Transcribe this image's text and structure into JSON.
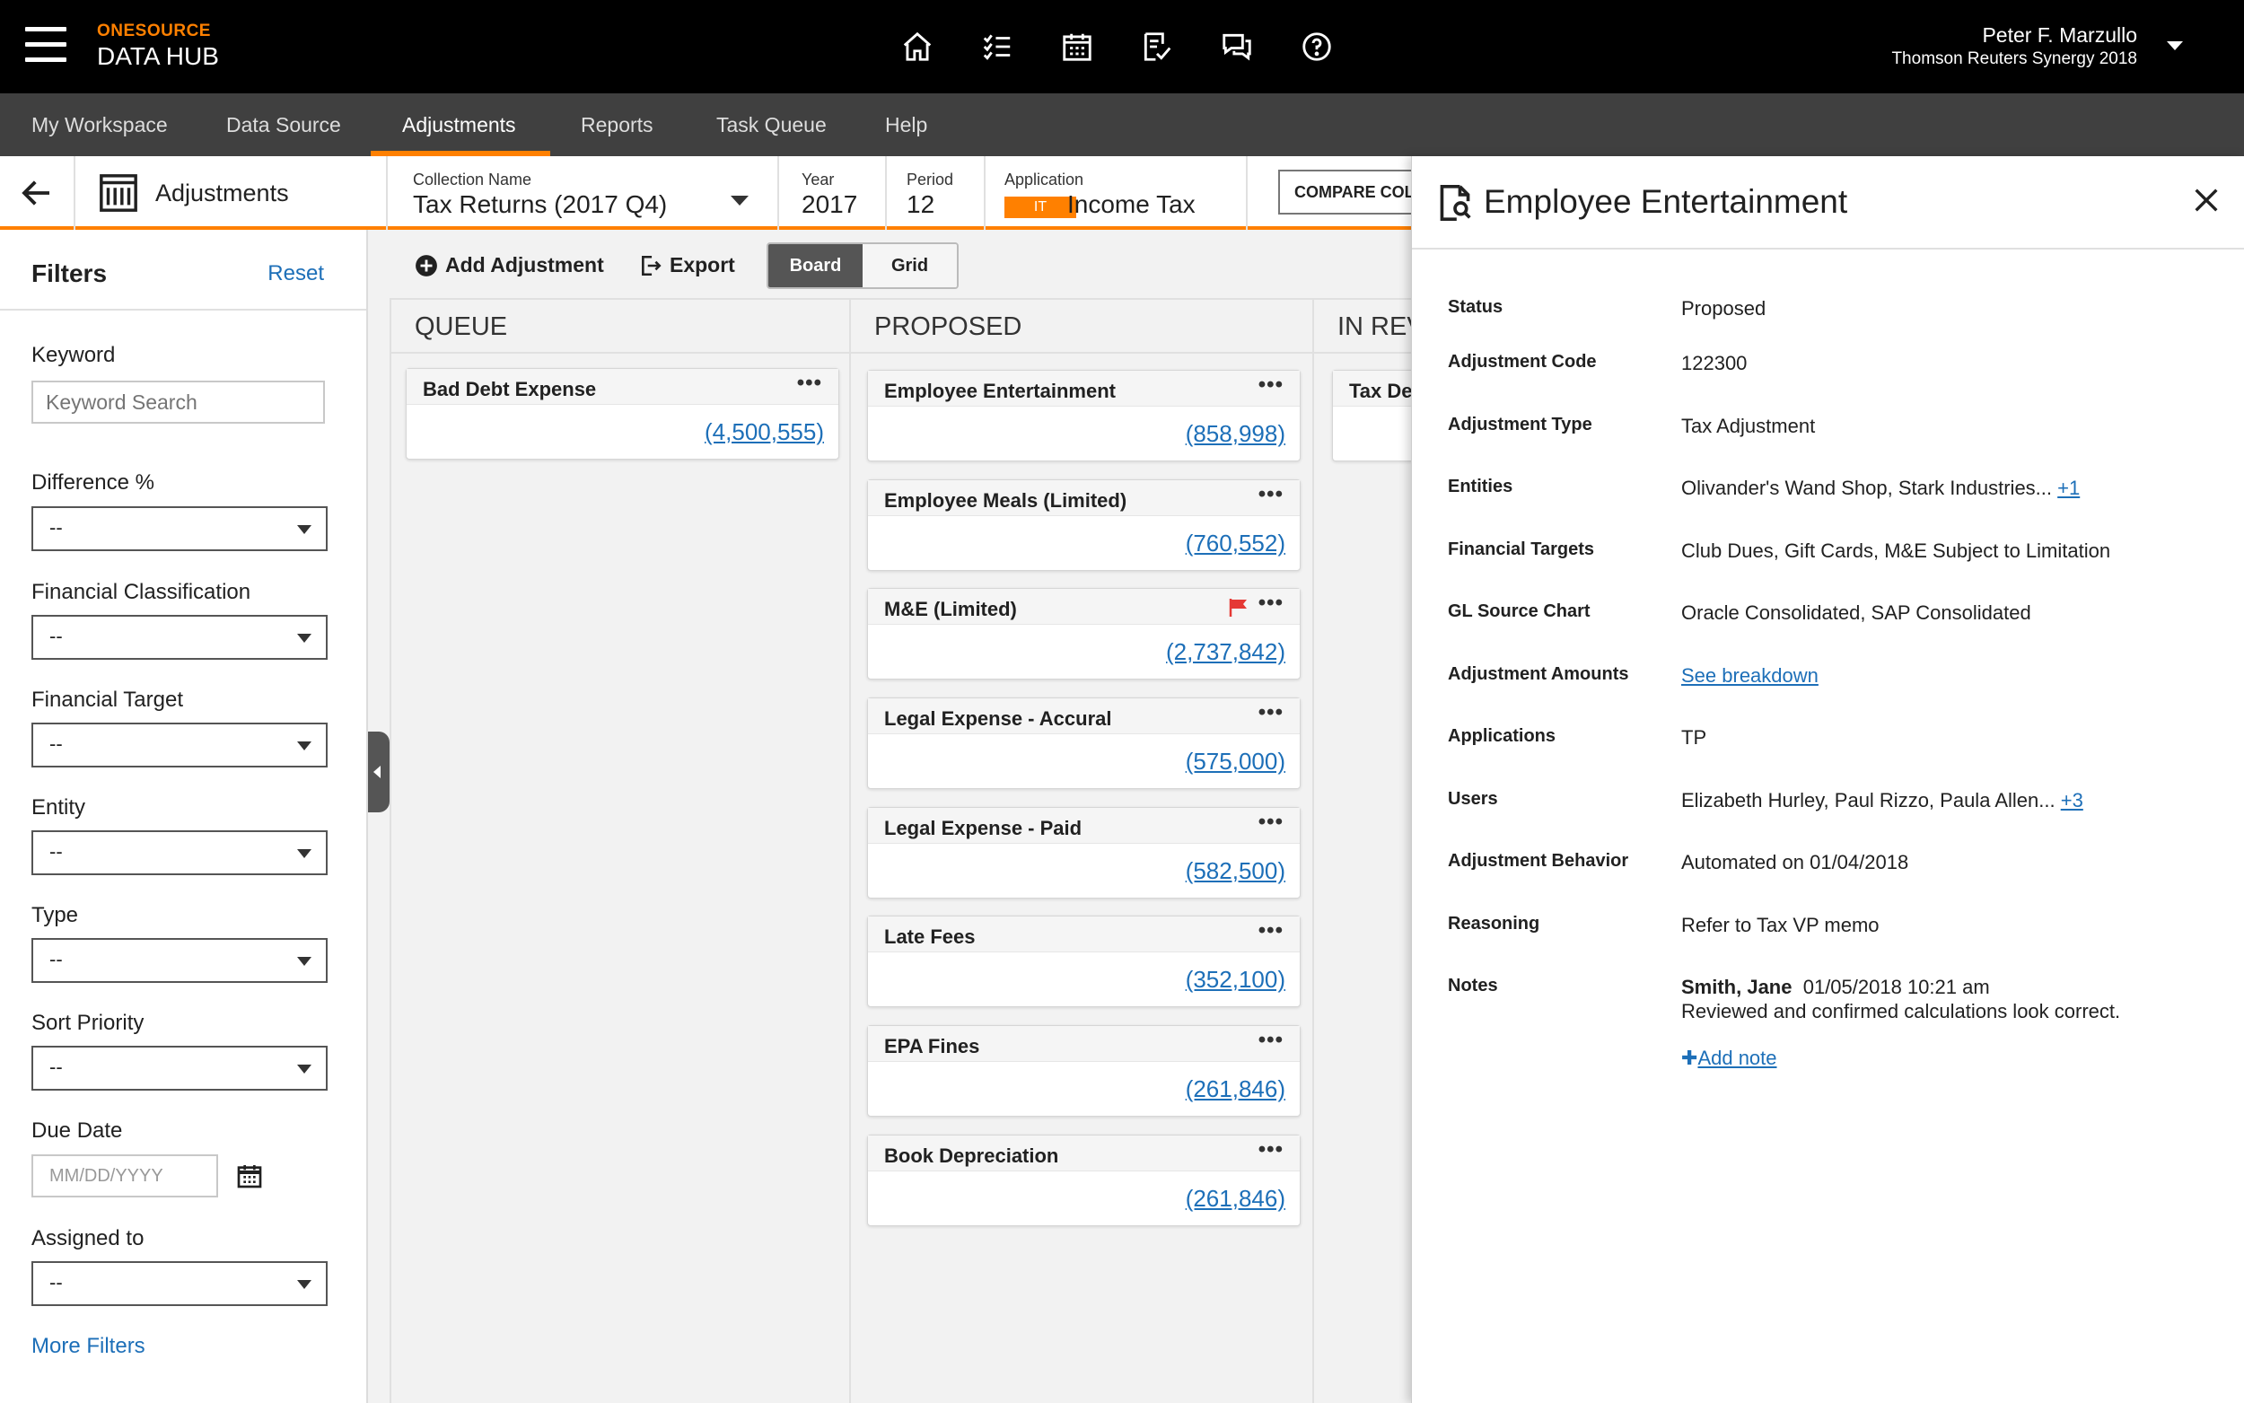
{
  "header": {
    "brand_top": "ONESOURCE",
    "brand_bottom": "DATA HUB",
    "user_name": "Peter F. Marzullo",
    "user_org": "Thomson Reuters Synergy 2018",
    "icons": [
      "home-icon",
      "task-list-icon",
      "calendar-icon",
      "review-icon",
      "chat-icon",
      "help-icon"
    ]
  },
  "nav": {
    "tabs": [
      {
        "label": "My Workspace"
      },
      {
        "label": "Data Source"
      },
      {
        "label": "Adjustments"
      },
      {
        "label": "Reports"
      },
      {
        "label": "Task Queue"
      },
      {
        "label": "Help"
      }
    ],
    "active": "Adjustments"
  },
  "context": {
    "title": "Adjustments",
    "collection_label": "Collection Name",
    "collection_value": "Tax Returns (2017 Q4)",
    "year_label": "Year",
    "year_value": "2017",
    "period_label": "Period",
    "period_value": "12",
    "application_label": "Application",
    "application_badge": "IT",
    "application_value": "Income Tax",
    "compare_label": "COMPARE COLL"
  },
  "filters": {
    "title": "Filters",
    "reset": "Reset",
    "keyword_label": "Keyword",
    "keyword_placeholder": "Keyword Search",
    "difference_label": "Difference %",
    "difference_value": "--",
    "fin_class_label": "Financial Classification",
    "fin_class_value": "--",
    "fin_target_label": "Financial Target",
    "fin_target_value": "--",
    "entity_label": "Entity",
    "entity_value": "--",
    "type_label": "Type",
    "type_value": "--",
    "priority_label": "Sort Priority",
    "priority_value": "--",
    "due_label": "Due Date",
    "due_placeholder": "MM/DD/YYYY",
    "assigned_label": "Assigned to",
    "assigned_value": "--",
    "more": "More Filters"
  },
  "toolbar": {
    "add": "Add Adjustment",
    "export": "Export",
    "board": "Board",
    "grid": "Grid"
  },
  "board": {
    "columns": [
      {
        "title": "QUEUE",
        "cards": [
          {
            "title": "Bad Debt Expense",
            "amount": "(4,500,555)"
          }
        ]
      },
      {
        "title": "PROPOSED",
        "cards": [
          {
            "title": "Employee Entertainment",
            "amount": "(858,998)"
          },
          {
            "title": "Employee Meals (Limited)",
            "amount": "(760,552)"
          },
          {
            "title": "M&E (Limited)",
            "amount": "(2,737,842)",
            "flag_color": "#e53935"
          },
          {
            "title": "Legal Expense - Accural",
            "amount": "(575,000)"
          },
          {
            "title": "Legal Expense - Paid",
            "amount": "(582,500)"
          },
          {
            "title": "Late Fees",
            "amount": "(352,100)"
          },
          {
            "title": "EPA Fines",
            "amount": "(261,846)"
          },
          {
            "title": "Book Depreciation",
            "amount": "(261,846)"
          }
        ]
      },
      {
        "title": "IN REV",
        "cards": [
          {
            "title": "Tax De",
            "amount": ""
          }
        ]
      }
    ]
  },
  "detail": {
    "title": "Employee Entertainment",
    "rows": [
      {
        "label": "Status",
        "value": "Proposed"
      },
      {
        "label": "Adjustment Code",
        "value": "122300"
      },
      {
        "label": "Adjustment Type",
        "value": "Tax Adjustment"
      },
      {
        "label": "Entities",
        "value": "Olivander's Wand Shop, Stark Industries...",
        "link": "+1"
      },
      {
        "label": "Financial Targets",
        "value": "Club Dues, Gift Cards, M&E Subject to Limitation"
      },
      {
        "label": "GL Source Chart",
        "value": "Oracle Consolidated, SAP Consolidated"
      },
      {
        "label": "Adjustment Amounts",
        "value": "",
        "link": "See breakdown"
      },
      {
        "label": "Applications",
        "value": "TP"
      },
      {
        "label": "Users",
        "value": "Elizabeth Hurley, Paul Rizzo, Paula Allen...",
        "link": "+3"
      },
      {
        "label": "Adjustment Behavior",
        "value": "Automated on 01/04/2018"
      },
      {
        "label": "Reasoning",
        "value": "Refer to Tax VP memo"
      }
    ],
    "notes_label": "Notes",
    "note_author": "Smith, Jane",
    "note_time": "01/05/2018 10:21 am",
    "note_text": "Reviewed and confirmed calculations look correct.",
    "add_note": "Add note"
  },
  "colors": {
    "accent": "#ff8000",
    "link": "#1d6fb8",
    "topbar": "#000000",
    "navbar": "#404040"
  }
}
